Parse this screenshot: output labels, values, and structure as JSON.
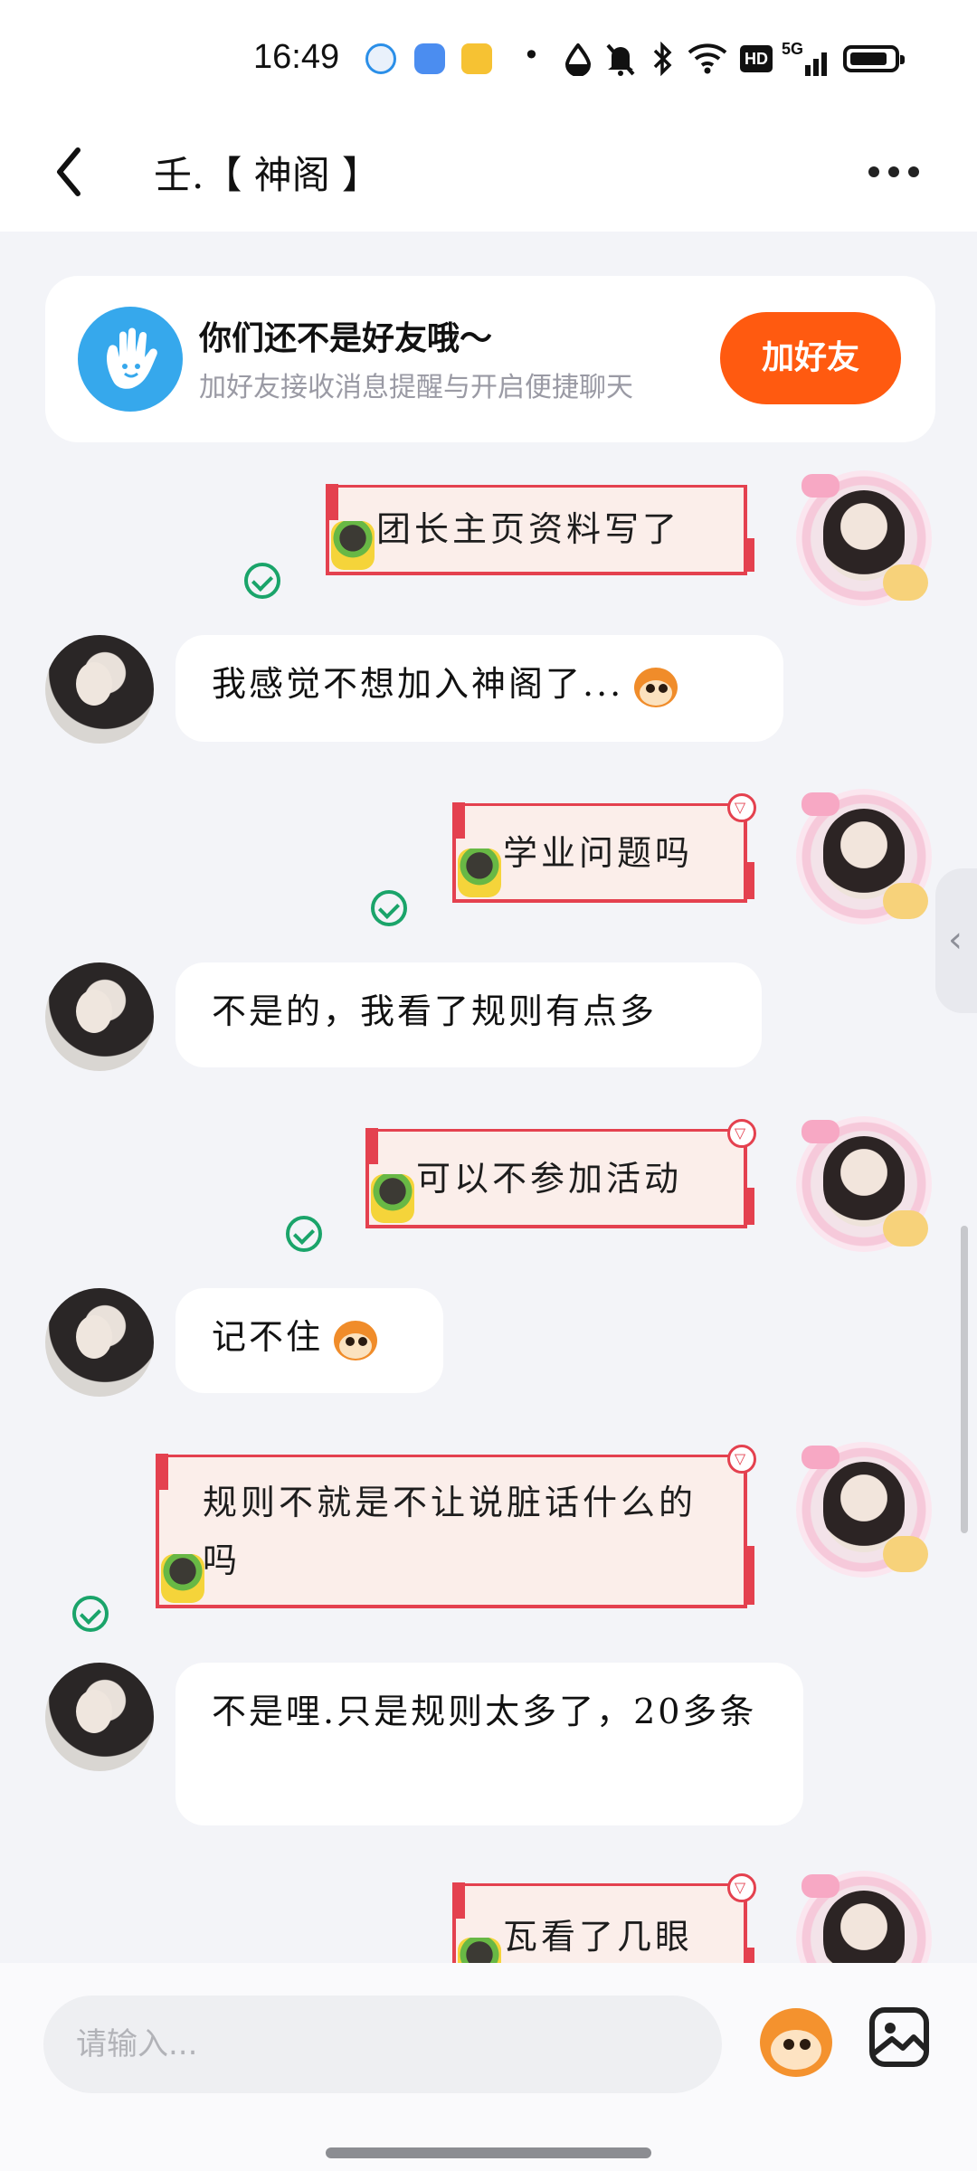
{
  "status_bar": {
    "time": "16:49",
    "dot": "•",
    "hd_label": "HD",
    "network_label": "5G",
    "icons": [
      "browser-icon",
      "app-icon",
      "notification-app-icon",
      "water-drop-icon",
      "mute-icon",
      "bluetooth-icon",
      "wifi-icon",
      "signal-icon",
      "battery-icon"
    ]
  },
  "header": {
    "title": "壬.【 神阁 】"
  },
  "friend_card": {
    "title": "你们还不是好友哦～",
    "subtitle": "加好友接收消息提醒与开启便捷聊天",
    "button_label": "加好友",
    "button_color": "#ff5a10",
    "icon_color": "#36a8ec"
  },
  "messages": [
    {
      "side": "right",
      "text": "团长主页资料写了",
      "status": "read"
    },
    {
      "side": "left",
      "text": "我感觉不想加入神阁了...",
      "emoji": "monkey-emoji"
    },
    {
      "side": "right",
      "text": "学业问题吗",
      "status": "read"
    },
    {
      "side": "left",
      "text": "不是的，我看了规则有点多"
    },
    {
      "side": "right",
      "text": "可以不参加活动",
      "status": "read"
    },
    {
      "side": "left",
      "text": "记不住",
      "emoji": "monkey-emoji"
    },
    {
      "side": "right",
      "text": "规则不就是不让说脏话什么的吗",
      "status": "read"
    },
    {
      "side": "left",
      "text": "不是哩.只是规则太多了，20多条"
    },
    {
      "side": "right",
      "text": "瓦看了几眼"
    }
  ],
  "input": {
    "placeholder": "请输入..."
  },
  "colors": {
    "bubble_border": "#e4414f",
    "bubble_fill": "#fbeeea",
    "read_check": "#1aa46a",
    "background": "#f3f4f8"
  }
}
